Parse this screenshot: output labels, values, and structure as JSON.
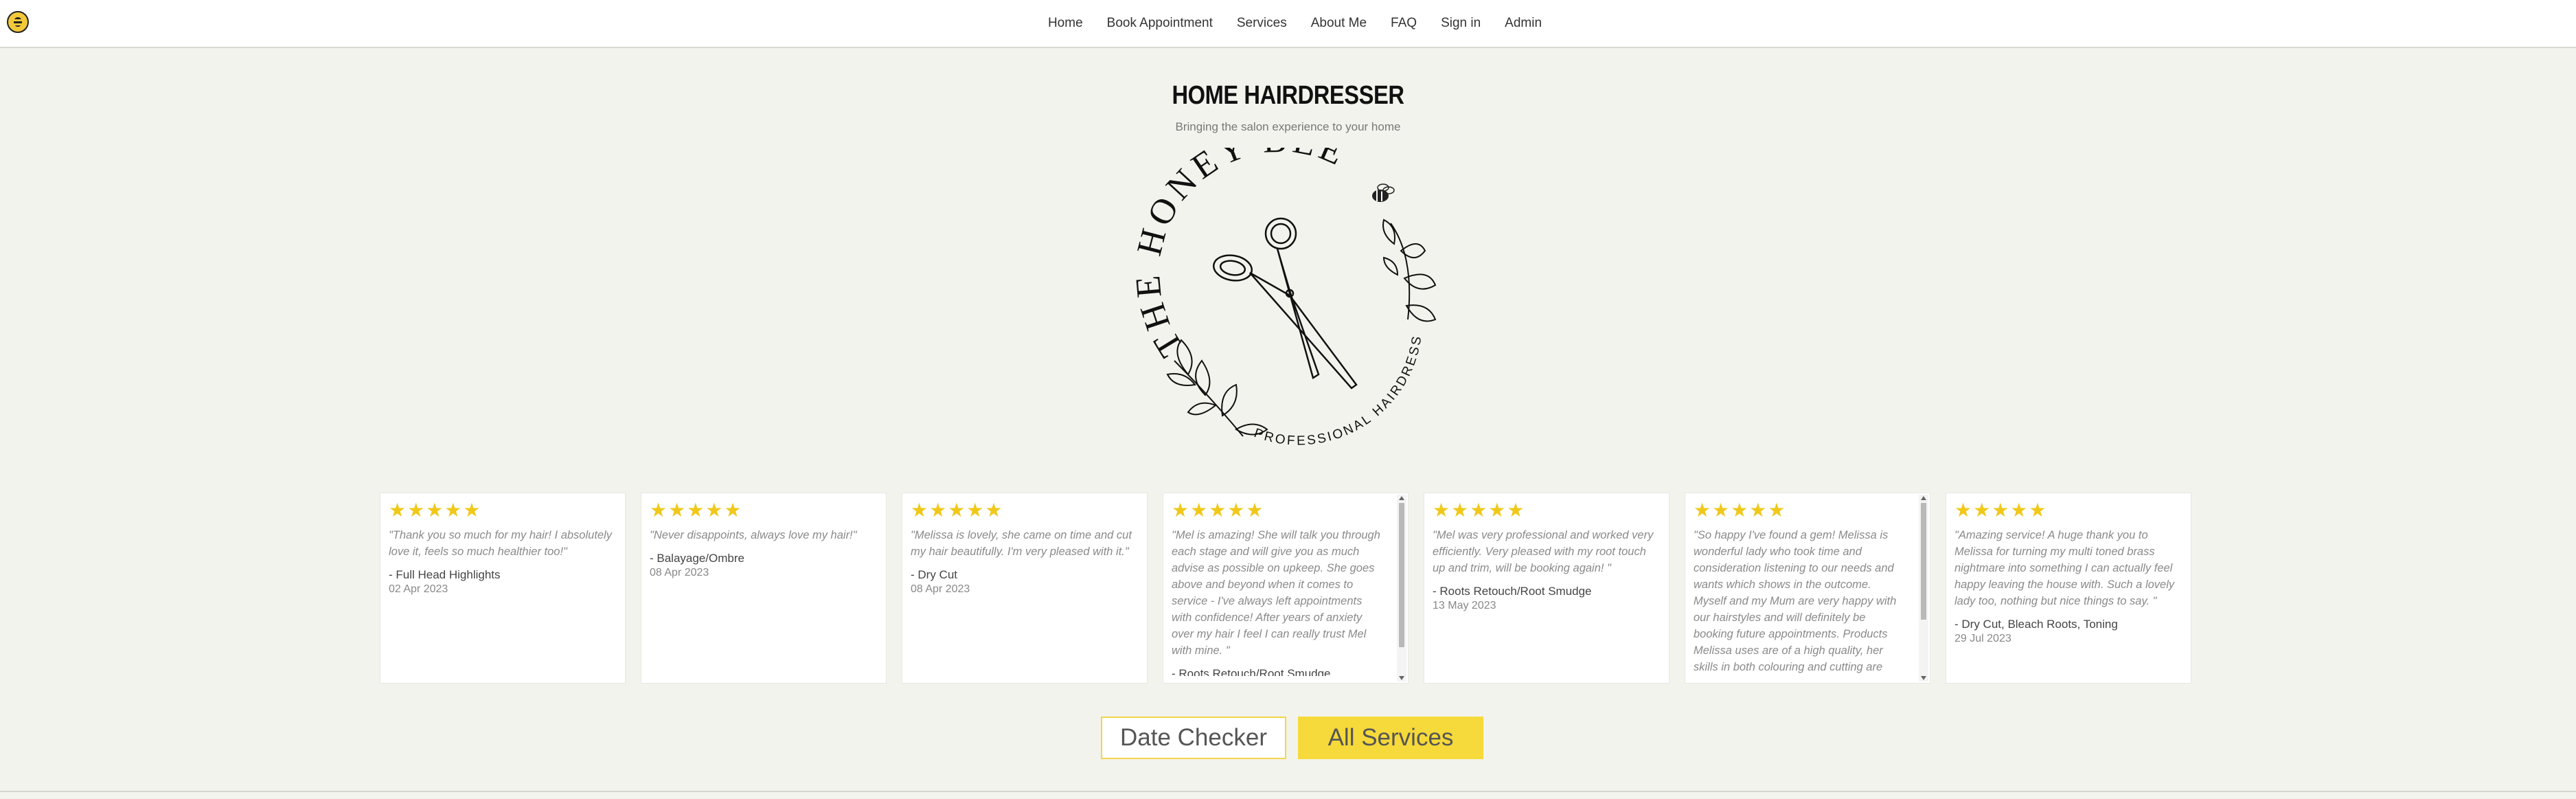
{
  "nav": {
    "links": [
      "Home",
      "Book Appointment",
      "Services",
      "About Me",
      "FAQ",
      "Sign in",
      "Admin"
    ]
  },
  "hero": {
    "title": "HOME HAIRDRESSER",
    "subtitle": "Bringing the salon experience to your home",
    "logo_arc_text": "THE HONEY BEE",
    "logo_bottom_text": "PROFESSIONAL HAIRDRESSER"
  },
  "reviews": [
    {
      "stars": "★★★★★",
      "text": "\"Thank you so much for my hair! I absolutely love it, feels so much healthier too!\"",
      "service": "- Full Head Highlights",
      "date": "02 Apr 2023"
    },
    {
      "stars": "★★★★★",
      "text": "\"Never disappoints, always love my hair!\"",
      "service": "- Balayage/Ombre",
      "date": "08 Apr 2023"
    },
    {
      "stars": "★★★★★",
      "text": "\"Melissa is lovely, she came on time and cut my hair beautifully. I'm very pleased with it.\"",
      "service": "- Dry Cut",
      "date": "08 Apr 2023"
    },
    {
      "stars": "★★★★★",
      "text": "\"Mel is amazing! She will talk you through each stage and will give you as much advise as possible on upkeep. She goes above and beyond when it comes to service - I've always left appointments with confidence! After years of anxiety over my hair I feel I can really trust Mel with mine. \"",
      "service": "- Roots Retouch/Root Smudge",
      "date": ""
    },
    {
      "stars": "★★★★★",
      "text": "\"Mel was very professional and worked very efficiently. Very pleased with my root touch up and trim, will be booking again! \"",
      "service": "- Roots Retouch/Root Smudge",
      "date": "13 May 2023"
    },
    {
      "stars": "★★★★★",
      "text": "\"So happy I've found a gem! Melissa is wonderful lady who took time and consideration listening to our needs and wants which shows in the outcome. Myself and my Mum are very happy with our hairstyles and will definitely be booking future appointments. Products Melissa uses are of a high quality, her skills in both colouring and cutting are great. Highly recommended-Thank",
      "service": "",
      "date": ""
    },
    {
      "stars": "★★★★★",
      "text": "\"Amazing service! A huge thank you to Melissa for turning my multi toned brass nightmare into something I can actually feel happy leaving the house with. Such a lovely lady too, nothing but nice things to say. \"",
      "service": "- Dry Cut, Bleach Roots, Toning",
      "date": "29 Jul 2023"
    }
  ],
  "buttons": {
    "date_checker": "Date Checker",
    "all_services": "All Services"
  },
  "colors": {
    "accent_yellow": "#f6d93a",
    "star": "#f0c81a",
    "background": "#f3f3ee"
  }
}
